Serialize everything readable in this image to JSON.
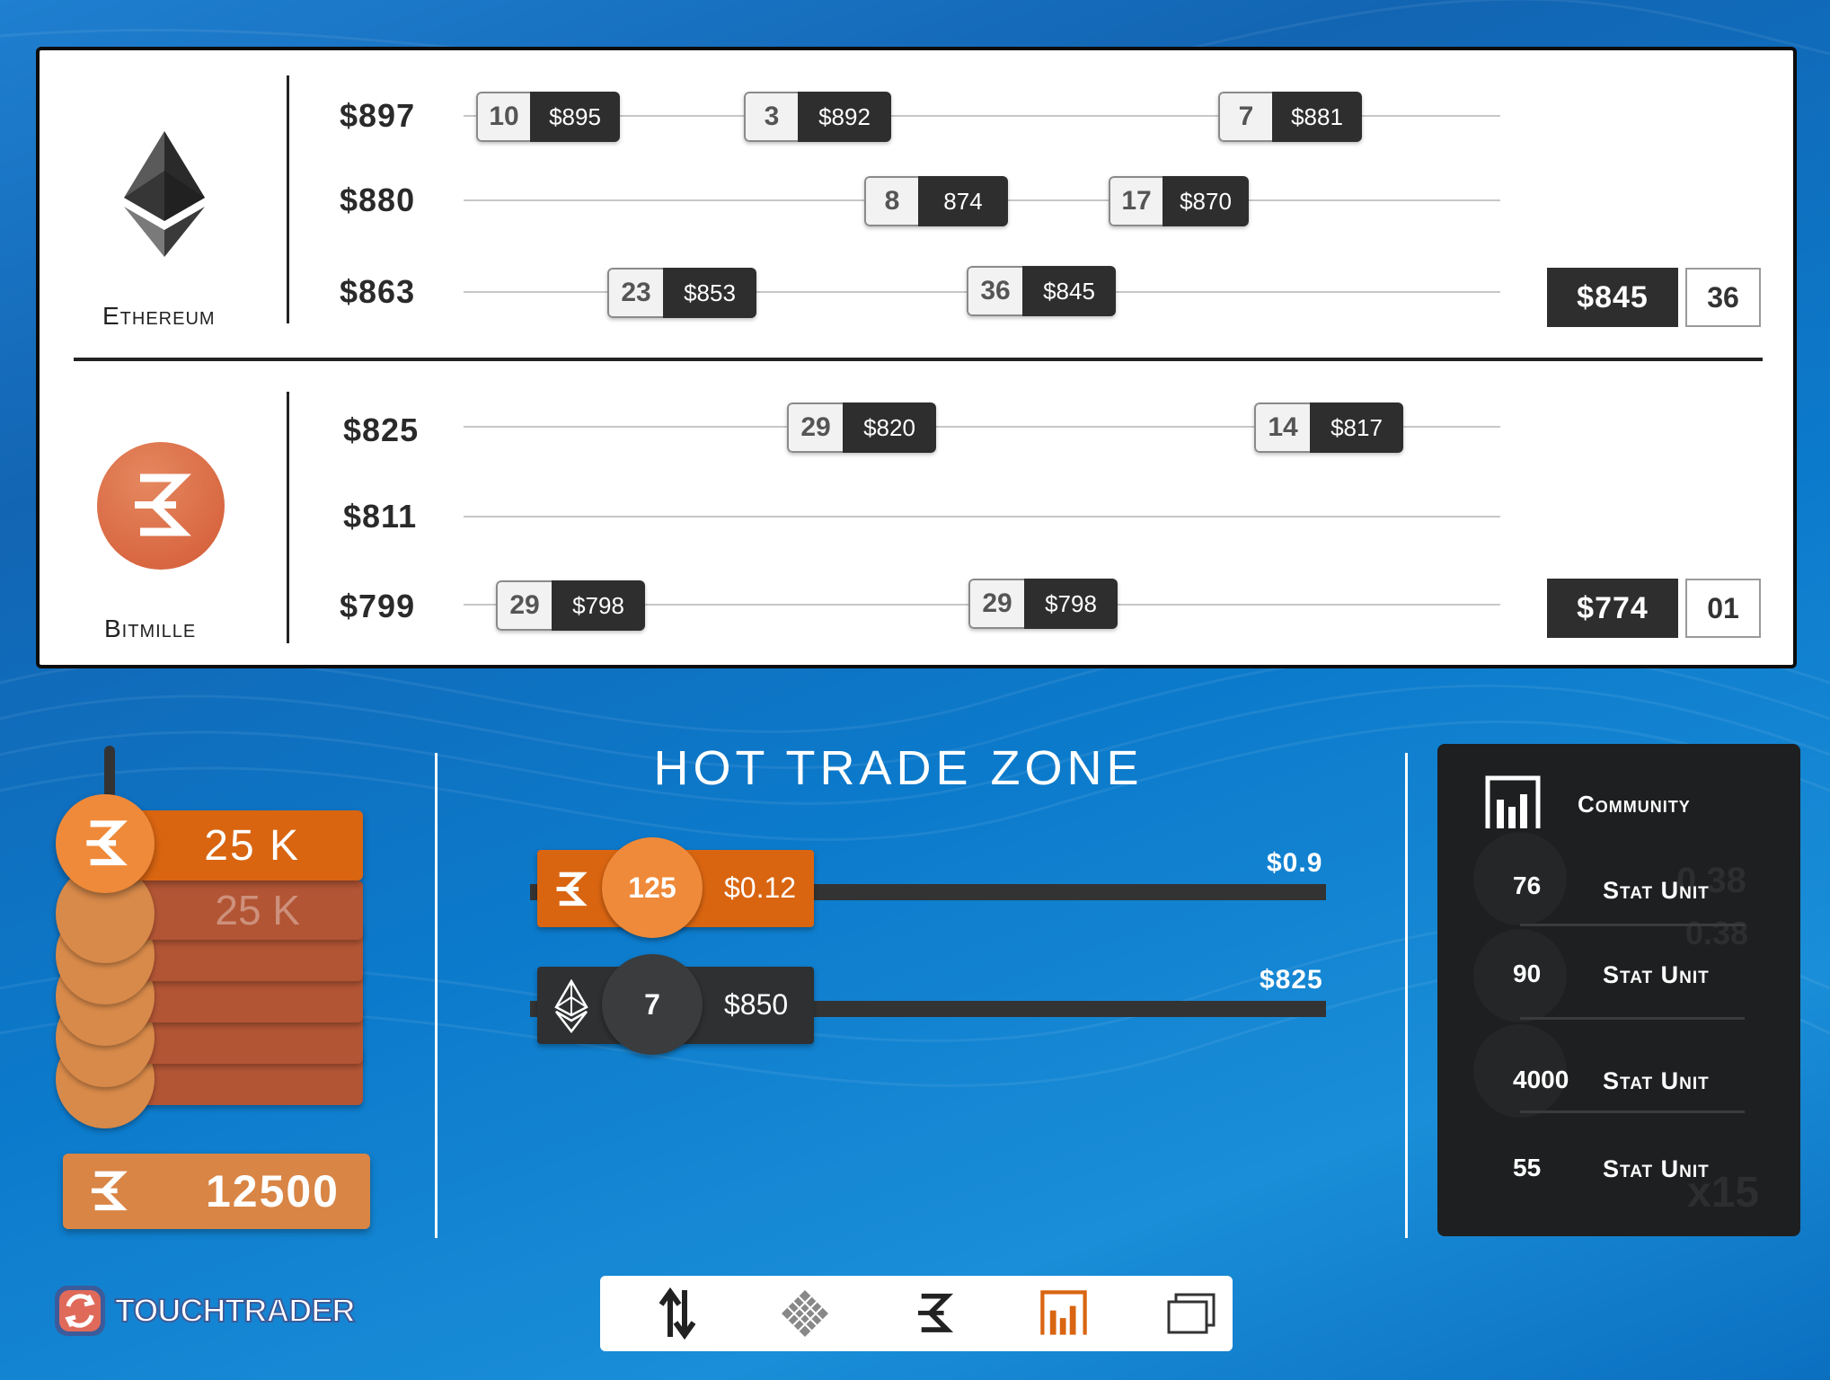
{
  "app": {
    "logo_text": "TOUCHTRADER"
  },
  "colors": {
    "accent_orange": "#d96511",
    "dark": "#2e2e2e",
    "bitmille": "#e0603a"
  },
  "ethereum": {
    "name": "Ethereum",
    "levels": [
      {
        "price": "$897",
        "orders": [
          {
            "qty": "10",
            "price": "$895"
          },
          {
            "qty": "3",
            "price": "$892"
          },
          {
            "qty": "7",
            "price": "$881"
          }
        ]
      },
      {
        "price": "$880",
        "orders": [
          {
            "qty": "8",
            "price": "874"
          },
          {
            "qty": "17",
            "price": "$870"
          }
        ]
      },
      {
        "price": "$863",
        "orders": [
          {
            "qty": "23",
            "price": "$853"
          },
          {
            "qty": "36",
            "price": "$845"
          }
        ]
      }
    ],
    "best": {
      "price": "$845",
      "qty": "36"
    }
  },
  "bitmille": {
    "name": "Bitmille",
    "levels": [
      {
        "price": "$825",
        "orders": [
          {
            "qty": "29",
            "price": "$820"
          },
          {
            "qty": "14",
            "price": "$817"
          }
        ]
      },
      {
        "price": "$811",
        "orders": []
      },
      {
        "price": "$799",
        "orders": [
          {
            "qty": "29",
            "price": "$798"
          },
          {
            "qty": "29",
            "price": "$798"
          }
        ]
      }
    ],
    "best": {
      "price": "$774",
      "qty": "01"
    }
  },
  "stack": {
    "top_label": "25 K",
    "shadow_label": "25 K",
    "balance": "12500"
  },
  "hot_trade_zone": {
    "title": "HOT TRADE ZONE",
    "rows": [
      {
        "icon": "bitmille-icon",
        "count": "125",
        "price": "$0.12",
        "max": "$0.9"
      },
      {
        "icon": "ethereum-icon",
        "count": "7",
        "price": "$850",
        "max": "$825"
      }
    ]
  },
  "community": {
    "title": "Community",
    "stats": [
      {
        "value": "76",
        "unit": "Stat Unit"
      },
      {
        "value": "90",
        "unit": "Stat Unit"
      },
      {
        "value": "4000",
        "unit": "Stat Unit"
      },
      {
        "value": "55",
        "unit": "Stat Unit"
      }
    ],
    "ghost_values": [
      "0.38",
      "0.38",
      "x15"
    ]
  },
  "nav": {
    "items": [
      "trade-icon",
      "grid-icon",
      "bitmille-icon",
      "chart-icon",
      "windows-icon"
    ]
  }
}
